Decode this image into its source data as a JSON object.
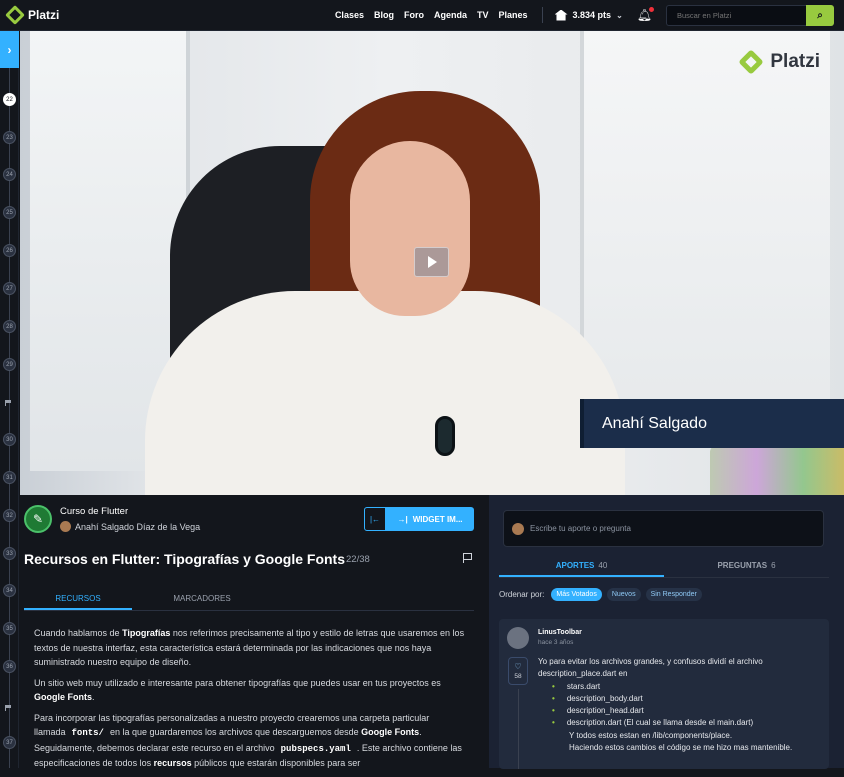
{
  "header": {
    "logo_text": "Platzi",
    "nav": [
      "Clases",
      "Blog",
      "Foro",
      "Agenda",
      "TV",
      "Planes"
    ],
    "points": "3.834 pts",
    "search_placeholder": "Buscar en Platzi",
    "search_button_icon": "search-icon"
  },
  "rail": {
    "toggle_icon": "chevron-right-icon",
    "items": [
      "22",
      "23",
      "24",
      "25",
      "26",
      "27",
      "28",
      "29",
      "30",
      "31",
      "32",
      "33",
      "34",
      "35",
      "36",
      "37"
    ],
    "current": "22"
  },
  "video": {
    "watermark": "Platzi",
    "presenter_name": "Anahí Salgado"
  },
  "course": {
    "name": "Curso de Flutter",
    "teacher": "Anahí Salgado Díaz de la Vega",
    "widget_label": "WIDGET IM..."
  },
  "lesson": {
    "title": "Recursos en Flutter: Tipografías y Google Fonts",
    "number": "22/38"
  },
  "tabs": [
    "RECURSOS",
    "MARCADORES"
  ],
  "article": {
    "p1_a": "Cuando hablamos de ",
    "p1_b": "Tipografías",
    "p1_c": " nos referimos precisamente al tipo y estilo de letras que usaremos en los textos de nuestra interfaz, esta característica estará determinada por las indicaciones que nos haya suministrado nuestro equipo de diseño.",
    "p2_a": "Un sitio web muy utilizado e interesante para obtener tipografías que puedes usar en tus proyectos es ",
    "p2_b": "Google Fonts",
    "p2_c": ".",
    "p3_a": "Para incorporar las tipografías personalizadas a nuestro proyecto crearemos una carpeta particular llamada",
    "p3_code1": "fonts/",
    "p3_b": "en la que guardaremos los archivos que descarguemos desde ",
    "p3_c": "Google Fonts",
    "p3_d": ". Seguidamente, debemos declarar este recurso en el archivo",
    "p3_code2": "pubspecs.yaml",
    "p3_e": ". Este archivo contiene las especificaciones de todos los ",
    "p3_f": "recursos",
    "p3_g": " públicos que estarán disponibles para ser"
  },
  "community": {
    "compose_placeholder": "Escribe tu aporte o pregunta",
    "tabs": [
      {
        "label": "APORTES",
        "count": "40"
      },
      {
        "label": "PREGUNTAS",
        "count": "6"
      }
    ],
    "order_label": "Ordenar por:",
    "order_options": [
      "Más Votados",
      "Nuevos",
      "Sin Responder"
    ],
    "post": {
      "user": "LinusToolbar",
      "time": "hace 3 años",
      "likes": "58",
      "line1": "Yo para evitar los archivos grandes, y confusos dividí el archivo",
      "line2": "description_place.dart en",
      "bullets": [
        "stars.dart",
        "description_body.dart",
        "description_head.dart",
        "description.dart (El cual se llama desde el main.dart)"
      ],
      "line3": "Y todos estos estan en /lib/components/place.",
      "line4": "Haciendo estos cambios el código se me hizo mas mantenible."
    }
  },
  "colors": {
    "accent": "#33b1ff",
    "brand": "#98ca3f",
    "background": "#13161c",
    "panel": "#1b2233"
  }
}
